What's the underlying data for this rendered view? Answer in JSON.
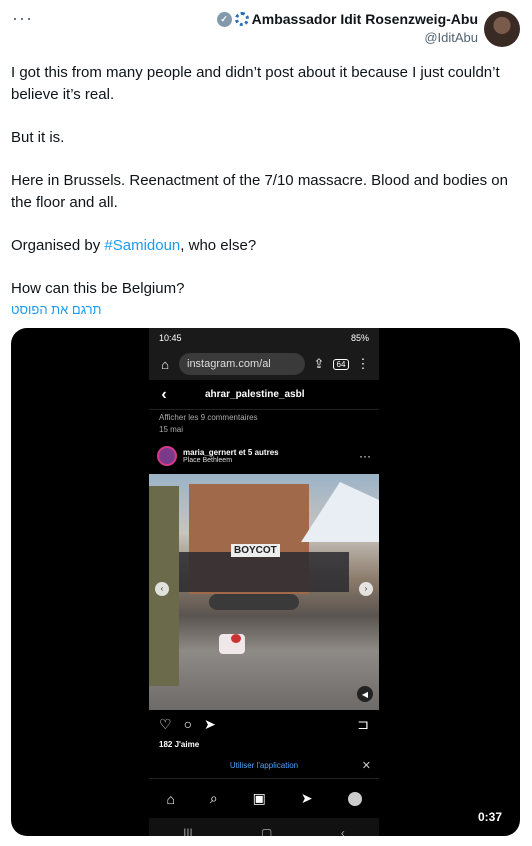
{
  "header": {
    "more_icon": "more-horizontal-icon",
    "display_name": "Ambassador Idit Rosenzweig-Abu",
    "handle": "@IditAbu",
    "verified_badge_color": "#829aab"
  },
  "tweet": {
    "paragraph1": "I got this from many people and didn’t post about  it because I just couldn’t believe it’s real.",
    "paragraph2": "But it is.",
    "paragraph3": "Here in Brussels. Reenactment of the 7/10 massacre. Blood and bodies on the floor and all.",
    "paragraph4_prefix": "Organised by ",
    "paragraph4_hashtag": "#Samidoun",
    "paragraph4_suffix": ", who else?",
    "paragraph5": "How can this be Belgium?",
    "translate_label": "תרגם את הפוסט",
    "link_color": "#1d9bf0"
  },
  "video": {
    "duration": "0:37",
    "phone": {
      "time": "10:45",
      "battery": "85%",
      "url": "instagram.com/al",
      "tab_count": "64",
      "profile_name": "ahrar_palestine_asbl",
      "comments_link": "Afficher les 9 commentaires",
      "date": "15 mai",
      "post_user": "maria_gernert et 5 autres",
      "post_location": "Place Bethleem",
      "photo_sign": "BOYCOT",
      "likes": "182 J'aime",
      "use_app": "Utiliser l'application"
    }
  }
}
